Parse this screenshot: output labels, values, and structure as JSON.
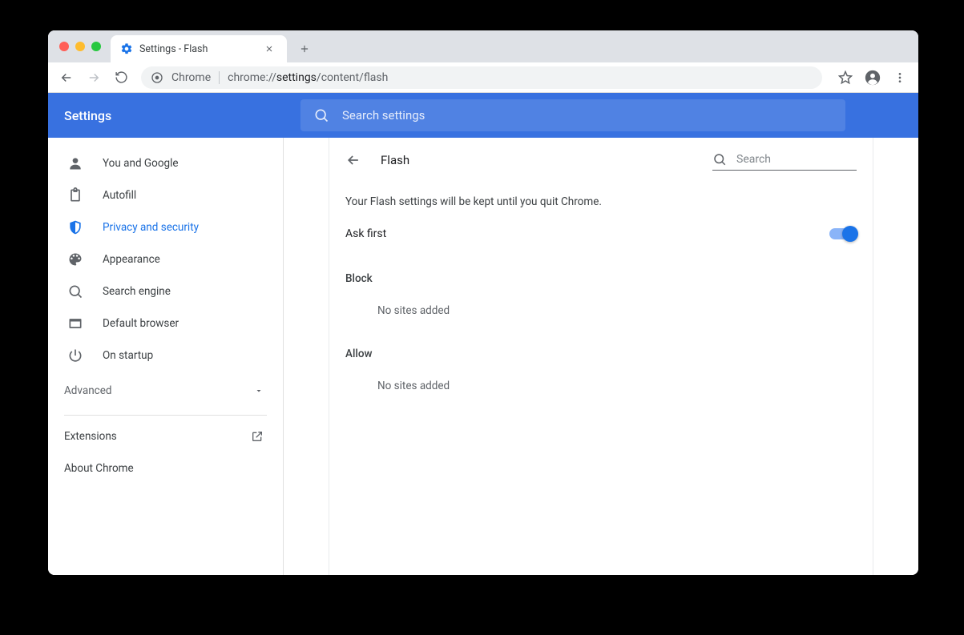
{
  "tab": {
    "title": "Settings - Flash"
  },
  "omnibox": {
    "scheme_label": "Chrome",
    "url_prefix": "chrome://",
    "url_bold": "settings",
    "url_suffix": "/content/flash"
  },
  "app": {
    "title": "Settings",
    "search_placeholder": "Search settings"
  },
  "sidebar": {
    "items": [
      {
        "id": "you-google",
        "label": "You and Google"
      },
      {
        "id": "autofill",
        "label": "Autofill"
      },
      {
        "id": "privacy",
        "label": "Privacy and security"
      },
      {
        "id": "appearance",
        "label": "Appearance"
      },
      {
        "id": "search",
        "label": "Search engine"
      },
      {
        "id": "default",
        "label": "Default browser"
      },
      {
        "id": "startup",
        "label": "On startup"
      }
    ],
    "advanced_label": "Advanced",
    "extensions_label": "Extensions",
    "about_label": "About Chrome"
  },
  "page": {
    "title": "Flash",
    "search_placeholder": "Search",
    "note": "Your Flash settings will be kept until you quit Chrome.",
    "ask_first_label": "Ask first",
    "ask_first_on": true,
    "block_header": "Block",
    "block_empty": "No sites added",
    "allow_header": "Allow",
    "allow_empty": "No sites added"
  }
}
